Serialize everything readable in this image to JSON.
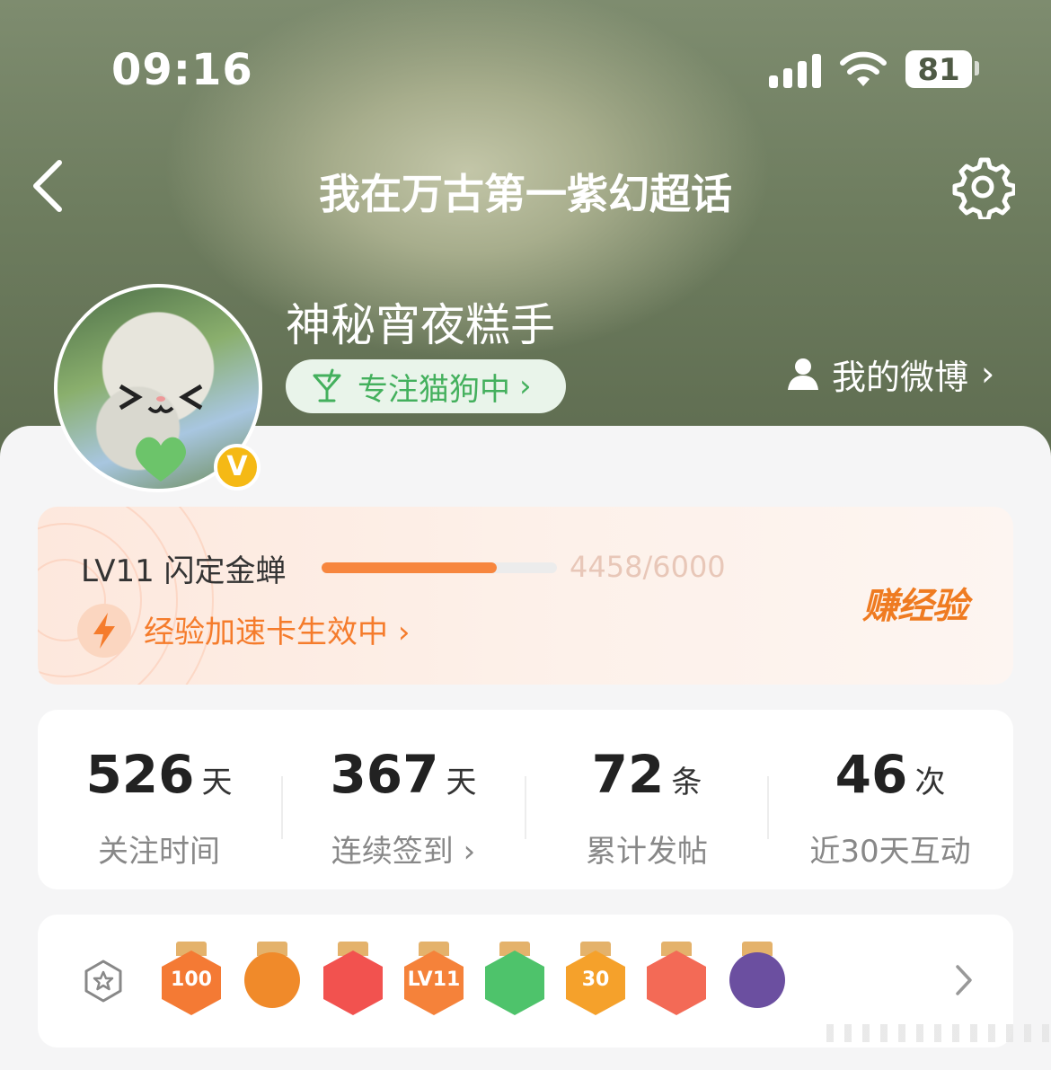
{
  "status_bar": {
    "time": "09:16",
    "battery": "81"
  },
  "nav": {
    "title": "我在万古第一紫幻超话"
  },
  "profile": {
    "username": "神秘宵夜糕手",
    "tag": "专注猫狗中",
    "my_weibo": "我的微博"
  },
  "level": {
    "name": "LV11 闪定金蝉",
    "exp": "4458/6000",
    "progress": 0.743,
    "boost": "经验加速卡生效中",
    "earn": "赚经验"
  },
  "stats": [
    {
      "value": "526",
      "unit": "天",
      "label": "关注时间"
    },
    {
      "value": "367",
      "unit": "天",
      "label": "连续签到"
    },
    {
      "value": "72",
      "unit": "条",
      "label": "累计发帖"
    },
    {
      "value": "46",
      "unit": "次",
      "label": "近30天互动"
    }
  ],
  "badges": [
    {
      "name": "100-days-medal",
      "text": "100",
      "color": "#f47a34"
    },
    {
      "name": "orange-character-medal",
      "text": "",
      "color": "#f08a2a"
    },
    {
      "name": "rabbit-medal",
      "text": "",
      "color": "#f2524f"
    },
    {
      "name": "lv11-medal",
      "text": "LV11",
      "color": "#f5823a"
    },
    {
      "name": "hand-medal",
      "text": "",
      "color": "#4ec36b"
    },
    {
      "name": "30-days-medal",
      "text": "30",
      "color": "#f5a12b"
    },
    {
      "name": "rock-hand-medal",
      "text": "",
      "color": "#f36a56"
    },
    {
      "name": "character-medal",
      "text": "",
      "color": "#6b4fa0"
    }
  ]
}
